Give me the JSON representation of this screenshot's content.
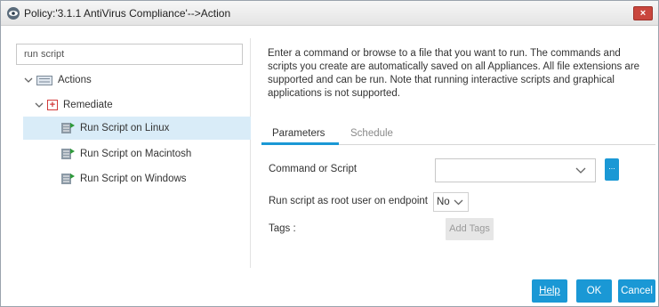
{
  "window": {
    "title": "Policy:'3.1.1 AntiVirus Compliance'-->Action",
    "close_label": "×"
  },
  "left": {
    "search_value": "run script",
    "tree": {
      "actions_label": "Actions",
      "remediate_label": "Remediate",
      "items": [
        {
          "label": "Run Script on Linux",
          "selected": true
        },
        {
          "label": "Run Script on Macintosh",
          "selected": false
        },
        {
          "label": "Run Script on Windows",
          "selected": false
        }
      ]
    }
  },
  "right": {
    "description": "Enter a command or browse to a file that you want to run. The commands and scripts you create are automatically saved on all Appliances. All file extensions are supported and can be run. Note that running interactive scripts and graphical applications is not supported.",
    "tabs": [
      {
        "label": "Parameters",
        "active": true
      },
      {
        "label": "Schedule",
        "active": false
      }
    ],
    "fields": {
      "command_label": "Command or Script",
      "command_value": "",
      "browse_label": "...",
      "root_label": "Run script as root user on endpoint",
      "root_value": "No",
      "tags_label": "Tags :",
      "add_tags_label": "Add Tags"
    }
  },
  "footer": {
    "help_label": "Help",
    "ok_label": "OK",
    "cancel_label": "Cancel"
  },
  "colors": {
    "accent": "#1a98d5",
    "selected_row": "#d9ecf8",
    "close_button": "#c9463d"
  },
  "icons": {
    "app": "forescout-eye-icon",
    "actions": "list-icon",
    "remediate": "plus-box-icon",
    "script": "script-icon"
  }
}
